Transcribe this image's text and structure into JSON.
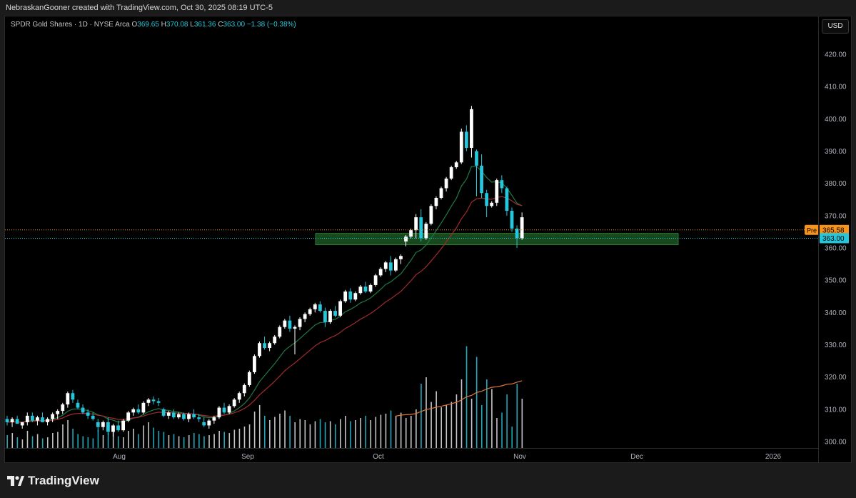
{
  "header": {
    "attribution": "NebraskanGooner created with TradingView.com, Oct 30, 2025 08:19 UTC-5"
  },
  "legend": {
    "symbol": "SPDR Gold Shares · 1D · NYSE Arca",
    "open_label": "O",
    "open": "369.65",
    "high_label": "H",
    "high": "370.08",
    "low_label": "L",
    "low": "361.36",
    "close_label": "C",
    "close": "363.00",
    "change": "−1.38 (−0.38%)"
  },
  "currency_button": "USD",
  "price_labels": {
    "pre_tag": "Pre",
    "pre_value": "365.58",
    "last_value": "363.00"
  },
  "colors": {
    "up": "#ffffff",
    "down": "#26c6da",
    "volume_up": "#e6e6e6",
    "volume_down": "#26c6da",
    "ma_fast": "#1f7a46",
    "ma_slow": "#a32a2a",
    "volume_ma": "#e07a3a",
    "zone_fill": "#1e5a24",
    "pre_line": "#f7931a",
    "last_line": "#26c6da"
  },
  "footer": {
    "brand": "TradingView"
  },
  "chart_data": {
    "type": "candlestick",
    "y_axis": {
      "min": 300,
      "max": 420,
      "ticks": [
        300,
        310,
        320,
        330,
        340,
        350,
        360,
        370,
        380,
        390,
        400,
        410,
        420
      ]
    },
    "x_axis": {
      "ticks": [
        "Aug",
        "Sep",
        "Oct",
        "Nov",
        "Dec",
        "2026"
      ]
    },
    "support_zone": {
      "low": 361.0,
      "high": 364.5
    },
    "pre_market_price": 365.58,
    "last_price": 363.0,
    "candles": [
      [
        307,
        308,
        305,
        306
      ],
      [
        306,
        307.5,
        304.5,
        307
      ],
      [
        307,
        308,
        305.5,
        305.5
      ],
      [
        305,
        306,
        304,
        306
      ],
      [
        306,
        309,
        305,
        308
      ],
      [
        308,
        309,
        306,
        306.5
      ],
      [
        306.5,
        308,
        305,
        307.5
      ],
      [
        307.5,
        309,
        306,
        306
      ],
      [
        306,
        307.5,
        305,
        307
      ],
      [
        307,
        309,
        306,
        308.5
      ],
      [
        308.5,
        310,
        307,
        309.5
      ],
      [
        309.5,
        312,
        308.5,
        311.5
      ],
      [
        311.5,
        315.5,
        310.5,
        315
      ],
      [
        315,
        316,
        312,
        313
      ],
      [
        312,
        313,
        310,
        310.5
      ],
      [
        310.5,
        311.5,
        308.5,
        309
      ],
      [
        309,
        310,
        307,
        308
      ],
      [
        308,
        309,
        306.5,
        307
      ],
      [
        306,
        307,
        303,
        304.5
      ],
      [
        304.5,
        306.5,
        303.5,
        306
      ],
      [
        306,
        307.5,
        302,
        303
      ],
      [
        303,
        305.5,
        301.5,
        305
      ],
      [
        305,
        306.5,
        303,
        303.5
      ],
      [
        303.5,
        307,
        303,
        306.5
      ],
      [
        306.5,
        309.5,
        306,
        309
      ],
      [
        309,
        310.5,
        308,
        310
      ],
      [
        310,
        311.5,
        308.5,
        309
      ],
      [
        309,
        312.5,
        308.5,
        312
      ],
      [
        312,
        313.5,
        311,
        313
      ],
      [
        313,
        314,
        311.5,
        312.5
      ],
      [
        312.5,
        313.5,
        311,
        312
      ],
      [
        310,
        310.5,
        307.5,
        308
      ],
      [
        308,
        309.5,
        307,
        309
      ],
      [
        309,
        310,
        307,
        307.5
      ],
      [
        307.5,
        309,
        307,
        308.5
      ],
      [
        308.5,
        309,
        306.5,
        307
      ],
      [
        307,
        309,
        306,
        308.5
      ],
      [
        308.5,
        310,
        307,
        307.5
      ],
      [
        307.5,
        308.5,
        306,
        307
      ],
      [
        306,
        307.5,
        304.5,
        305
      ],
      [
        305,
        307,
        304,
        306.5
      ],
      [
        306.5,
        308,
        305.5,
        307.5
      ],
      [
        307.5,
        311,
        307,
        310.5
      ],
      [
        310.5,
        312,
        308.5,
        309
      ],
      [
        309,
        311.5,
        308.5,
        311
      ],
      [
        311,
        313.5,
        310.5,
        313
      ],
      [
        313,
        315.5,
        312,
        315
      ],
      [
        315,
        318,
        314,
        317.5
      ],
      [
        317.5,
        322,
        317,
        321.5
      ],
      [
        321.5,
        327,
        321,
        326.5
      ],
      [
        326.5,
        331,
        326,
        330.5
      ],
      [
        330.5,
        332.5,
        328.5,
        329
      ],
      [
        329,
        331,
        328,
        330.5
      ],
      [
        330.5,
        333,
        330,
        332.5
      ],
      [
        332.5,
        336,
        332,
        335.5
      ],
      [
        335.5,
        338,
        335,
        337.5
      ],
      [
        337.5,
        339,
        334,
        335
      ],
      [
        335,
        336,
        327,
        335.5
      ],
      [
        335.5,
        338.5,
        334.5,
        338
      ],
      [
        338,
        340,
        337,
        339.5
      ],
      [
        339.5,
        341.5,
        339,
        341
      ],
      [
        341,
        343,
        340,
        342.5
      ],
      [
        342.5,
        343.5,
        340,
        340.5
      ],
      [
        340.5,
        341.5,
        335.5,
        337
      ],
      [
        337,
        341,
        336.5,
        340.5
      ],
      [
        340.5,
        342,
        338.5,
        339
      ],
      [
        339,
        344,
        338.5,
        343.5
      ],
      [
        343.5,
        347,
        343,
        346.5
      ],
      [
        346.5,
        347.5,
        343,
        344
      ],
      [
        344,
        346.5,
        343.5,
        346
      ],
      [
        346,
        348.5,
        345.5,
        348
      ],
      [
        348,
        349.5,
        346,
        346.5
      ],
      [
        346.5,
        349,
        346,
        348.5
      ],
      [
        348.5,
        352,
        348,
        351.5
      ],
      [
        351.5,
        354,
        351,
        353.5
      ],
      [
        353.5,
        356,
        352.5,
        355.5
      ],
      [
        355.5,
        357.5,
        351.5,
        353
      ],
      [
        353,
        357,
        352.5,
        356.5
      ],
      [
        356.5,
        358,
        355,
        357.5
      ],
      [
        362,
        364,
        360.5,
        363.5
      ],
      [
        363.5,
        366,
        363,
        365.5
      ],
      [
        365.5,
        370.5,
        363,
        369.5
      ],
      [
        369.5,
        372,
        362,
        363
      ],
      [
        363,
        368,
        362.5,
        367.5
      ],
      [
        367.5,
        373.5,
        367,
        373
      ],
      [
        373,
        376,
        372,
        375.5
      ],
      [
        375.5,
        379,
        375,
        378.5
      ],
      [
        378.5,
        382,
        377.5,
        381.5
      ],
      [
        381.5,
        385.5,
        381,
        385
      ],
      [
        385,
        387,
        384.5,
        386.5
      ],
      [
        386.5,
        397,
        386,
        396
      ],
      [
        396,
        398,
        390,
        391
      ],
      [
        391,
        404,
        388,
        403
      ],
      [
        390,
        390.5,
        376,
        385.5
      ],
      [
        385.5,
        389,
        375.5,
        377
      ],
      [
        377,
        378,
        369.5,
        373
      ],
      [
        373,
        374.5,
        372.5,
        374
      ],
      [
        374,
        381.5,
        373,
        381
      ],
      [
        381,
        382.5,
        377,
        378.5
      ],
      [
        378.5,
        379,
        370,
        371.5
      ],
      [
        371.5,
        372.5,
        365,
        366
      ],
      [
        366,
        367,
        360,
        363
      ],
      [
        363,
        371,
        362.5,
        369.5
      ]
    ],
    "volume_scale_max": 100,
    "volumes": [
      12,
      14,
      10,
      8,
      16,
      11,
      13,
      9,
      10,
      14,
      15,
      22,
      26,
      18,
      13,
      11,
      10,
      9,
      17,
      12,
      14,
      16,
      11,
      10,
      16,
      18,
      13,
      21,
      24,
      19,
      16,
      15,
      12,
      13,
      11,
      10,
      12,
      14,
      13,
      11,
      12,
      13,
      16,
      15,
      14,
      17,
      18,
      20,
      22,
      34,
      40,
      30,
      26,
      29,
      32,
      35,
      30,
      24,
      27,
      26,
      22,
      25,
      27,
      24,
      25,
      22,
      27,
      30,
      25,
      26,
      28,
      30,
      26,
      29,
      31,
      32,
      35,
      30,
      33,
      28,
      30,
      36,
      60,
      66,
      43,
      53,
      38,
      40,
      43,
      50,
      64,
      95,
      46,
      85,
      40,
      64,
      55,
      28,
      33,
      50,
      20,
      60,
      46
    ],
    "volume_ma_series_hint": "rising from ~18 to ~48 over the last 40 bars"
  }
}
